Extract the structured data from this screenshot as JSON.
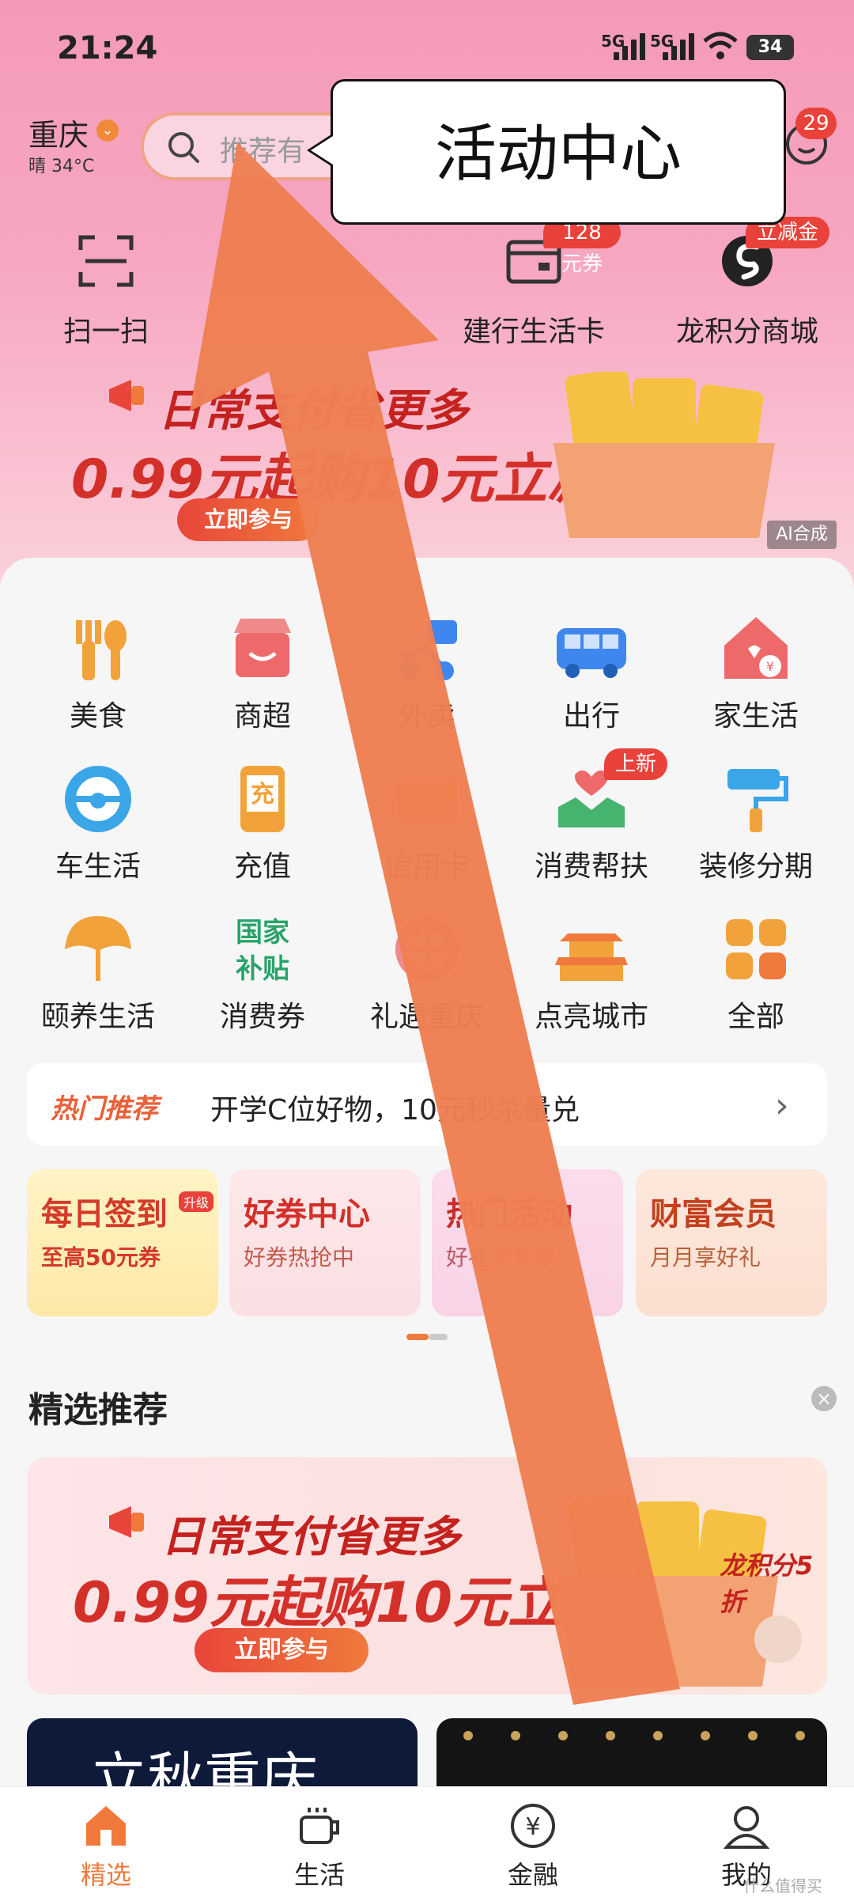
{
  "status_bar": {
    "time": "21:24",
    "net1": "5G",
    "net2": "5G",
    "battery": "34"
  },
  "header": {
    "city": "重庆",
    "weather": "晴 34°C",
    "search_placeholder": "推荐有",
    "messages_badge": "29"
  },
  "callout": {
    "text": "活动中心"
  },
  "quick_actions": [
    {
      "label": "扫一扫",
      "icon": "scan-icon",
      "badge": ""
    },
    {
      "label": "建行生活卡",
      "icon": "card-icon",
      "badge": "128元券"
    },
    {
      "label": "龙积分商城",
      "icon": "points-mall-icon",
      "badge": "立减金"
    }
  ],
  "top_banner": {
    "line1": "日常支付省更多",
    "line2": "0.99元起购10元立减金",
    "button": "立即参与",
    "ai_tag": "AI合成"
  },
  "categories": [
    {
      "label": "美食",
      "icon": "food-icon",
      "badge": ""
    },
    {
      "label": "商超",
      "icon": "supermarket-icon",
      "badge": ""
    },
    {
      "label": "外卖",
      "icon": "delivery-icon",
      "badge": ""
    },
    {
      "label": "出行",
      "icon": "bus-icon",
      "badge": ""
    },
    {
      "label": "家生活",
      "icon": "home-icon",
      "badge": ""
    },
    {
      "label": "车生活",
      "icon": "steering-wheel-icon",
      "badge": ""
    },
    {
      "label": "充值",
      "icon": "recharge-icon",
      "badge": ""
    },
    {
      "label": "信用卡",
      "icon": "credit-card-icon",
      "badge": ""
    },
    {
      "label": "消费帮扶",
      "icon": "helping-hands-icon",
      "badge": "上新"
    },
    {
      "label": "装修分期",
      "icon": "paint-roller-icon",
      "badge": ""
    },
    {
      "label": "颐养生活",
      "icon": "ginkgo-icon",
      "badge": ""
    },
    {
      "label": "消费券",
      "icon": "national-subsidy-icon",
      "badge": "",
      "icon_text": "国家补贴"
    },
    {
      "label": "礼遇重庆",
      "icon": "gift-icon",
      "badge": ""
    },
    {
      "label": "点亮城市",
      "icon": "city-gate-icon",
      "badge": ""
    },
    {
      "label": "全部",
      "icon": "all-apps-icon",
      "badge": ""
    }
  ],
  "hot_recommend": {
    "tag": "热门推荐",
    "text": "开学C位好物，10元秒杀量兑"
  },
  "promo_cards": [
    {
      "title": "每日签到",
      "sub": "至高50元券",
      "up": "升级"
    },
    {
      "title": "好券中心",
      "sub": "好券热抢中",
      "up": ""
    },
    {
      "title": "热门活动",
      "sub": "好礼天天享",
      "up": ""
    },
    {
      "title": "财富会员",
      "sub": "月月享好礼",
      "up": ""
    }
  ],
  "section": {
    "title": "精选推荐"
  },
  "feature_banner": {
    "line1": "日常支付省更多",
    "line2": "0.99元起购10元立减金",
    "button": "立即参与",
    "tag": "龙积分5折"
  },
  "tiles": {
    "a_text": "立秋重庆"
  },
  "tabbar": [
    {
      "label": "精选",
      "icon": "home-tab-icon",
      "active": true
    },
    {
      "label": "生活",
      "icon": "cup-icon",
      "active": false
    },
    {
      "label": "金融",
      "icon": "yuan-icon",
      "active": false
    },
    {
      "label": "我的",
      "icon": "user-icon",
      "active": false
    }
  ],
  "watermark": "什么值得买",
  "colors": {
    "accent": "#f07a3c",
    "red": "#e8423a",
    "arrow": "#ee7f52",
    "header_pink": "#f49ab8"
  }
}
